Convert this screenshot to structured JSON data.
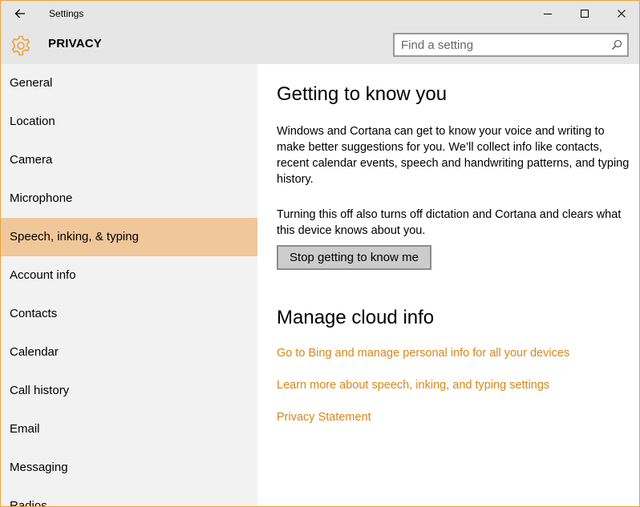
{
  "window": {
    "title": "Settings",
    "border_color": "#e8a33d",
    "controls": [
      "minimize-icon",
      "maximize-icon",
      "close-icon"
    ]
  },
  "header": {
    "section_title": "PRIVACY",
    "icon": "gear-icon",
    "search": {
      "value": "",
      "placeholder": "Find a setting",
      "icon": "search-icon"
    }
  },
  "sidebar": {
    "items": [
      {
        "label": "General",
        "selected": false
      },
      {
        "label": "Location",
        "selected": false
      },
      {
        "label": "Camera",
        "selected": false
      },
      {
        "label": "Microphone",
        "selected": false
      },
      {
        "label": "Speech, inking, & typing",
        "selected": true
      },
      {
        "label": "Account info",
        "selected": false
      },
      {
        "label": "Contacts",
        "selected": false
      },
      {
        "label": "Calendar",
        "selected": false
      },
      {
        "label": "Call history",
        "selected": false
      },
      {
        "label": "Email",
        "selected": false
      },
      {
        "label": "Messaging",
        "selected": false
      },
      {
        "label": "Radios",
        "selected": false
      }
    ],
    "selected_color": "#f0c799"
  },
  "main": {
    "section1": {
      "heading": "Getting to know you",
      "paragraph1": "Windows and Cortana can get to know your voice and writing to make better suggestions for you. We’ll collect info like contacts, recent calendar events, speech and handwriting patterns, and typing history.",
      "paragraph2": "Turning this off also turns off dictation and Cortana and clears what this device knows about you.",
      "button_label": "Stop getting to know me"
    },
    "section2": {
      "heading": "Manage cloud info",
      "links": [
        "Go to Bing and manage personal info for all your devices",
        "Learn more about speech, inking, and typing settings",
        "Privacy Statement"
      ]
    },
    "accent_color": "#d88617"
  }
}
